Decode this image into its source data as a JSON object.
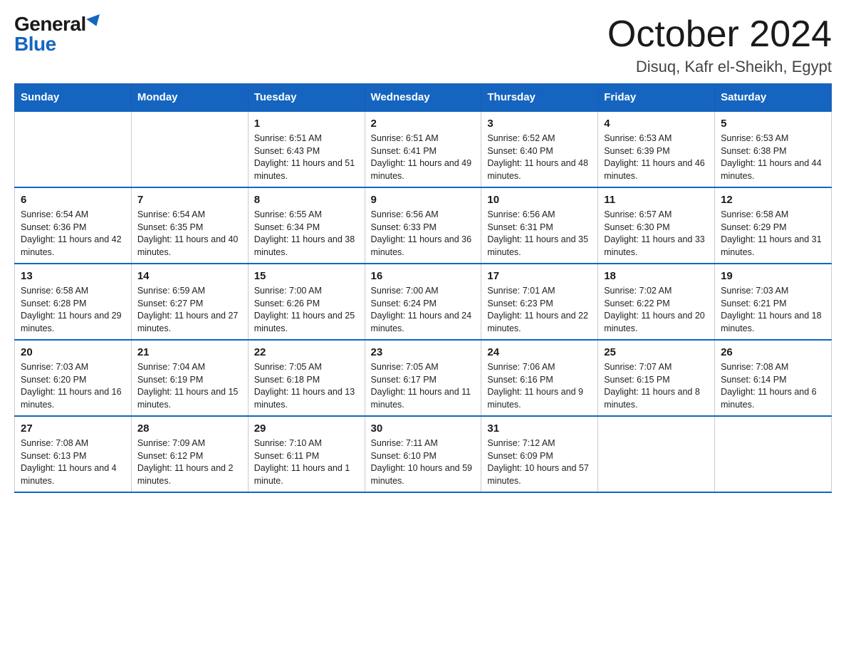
{
  "logo": {
    "general": "General",
    "blue": "Blue"
  },
  "header": {
    "month": "October 2024",
    "location": "Disuq, Kafr el-Sheikh, Egypt"
  },
  "days_of_week": [
    "Sunday",
    "Monday",
    "Tuesday",
    "Wednesday",
    "Thursday",
    "Friday",
    "Saturday"
  ],
  "weeks": [
    [
      {
        "day": "",
        "sunrise": "",
        "sunset": "",
        "daylight": ""
      },
      {
        "day": "",
        "sunrise": "",
        "sunset": "",
        "daylight": ""
      },
      {
        "day": "1",
        "sunrise": "Sunrise: 6:51 AM",
        "sunset": "Sunset: 6:43 PM",
        "daylight": "Daylight: 11 hours and 51 minutes."
      },
      {
        "day": "2",
        "sunrise": "Sunrise: 6:51 AM",
        "sunset": "Sunset: 6:41 PM",
        "daylight": "Daylight: 11 hours and 49 minutes."
      },
      {
        "day": "3",
        "sunrise": "Sunrise: 6:52 AM",
        "sunset": "Sunset: 6:40 PM",
        "daylight": "Daylight: 11 hours and 48 minutes."
      },
      {
        "day": "4",
        "sunrise": "Sunrise: 6:53 AM",
        "sunset": "Sunset: 6:39 PM",
        "daylight": "Daylight: 11 hours and 46 minutes."
      },
      {
        "day": "5",
        "sunrise": "Sunrise: 6:53 AM",
        "sunset": "Sunset: 6:38 PM",
        "daylight": "Daylight: 11 hours and 44 minutes."
      }
    ],
    [
      {
        "day": "6",
        "sunrise": "Sunrise: 6:54 AM",
        "sunset": "Sunset: 6:36 PM",
        "daylight": "Daylight: 11 hours and 42 minutes."
      },
      {
        "day": "7",
        "sunrise": "Sunrise: 6:54 AM",
        "sunset": "Sunset: 6:35 PM",
        "daylight": "Daylight: 11 hours and 40 minutes."
      },
      {
        "day": "8",
        "sunrise": "Sunrise: 6:55 AM",
        "sunset": "Sunset: 6:34 PM",
        "daylight": "Daylight: 11 hours and 38 minutes."
      },
      {
        "day": "9",
        "sunrise": "Sunrise: 6:56 AM",
        "sunset": "Sunset: 6:33 PM",
        "daylight": "Daylight: 11 hours and 36 minutes."
      },
      {
        "day": "10",
        "sunrise": "Sunrise: 6:56 AM",
        "sunset": "Sunset: 6:31 PM",
        "daylight": "Daylight: 11 hours and 35 minutes."
      },
      {
        "day": "11",
        "sunrise": "Sunrise: 6:57 AM",
        "sunset": "Sunset: 6:30 PM",
        "daylight": "Daylight: 11 hours and 33 minutes."
      },
      {
        "day": "12",
        "sunrise": "Sunrise: 6:58 AM",
        "sunset": "Sunset: 6:29 PM",
        "daylight": "Daylight: 11 hours and 31 minutes."
      }
    ],
    [
      {
        "day": "13",
        "sunrise": "Sunrise: 6:58 AM",
        "sunset": "Sunset: 6:28 PM",
        "daylight": "Daylight: 11 hours and 29 minutes."
      },
      {
        "day": "14",
        "sunrise": "Sunrise: 6:59 AM",
        "sunset": "Sunset: 6:27 PM",
        "daylight": "Daylight: 11 hours and 27 minutes."
      },
      {
        "day": "15",
        "sunrise": "Sunrise: 7:00 AM",
        "sunset": "Sunset: 6:26 PM",
        "daylight": "Daylight: 11 hours and 25 minutes."
      },
      {
        "day": "16",
        "sunrise": "Sunrise: 7:00 AM",
        "sunset": "Sunset: 6:24 PM",
        "daylight": "Daylight: 11 hours and 24 minutes."
      },
      {
        "day": "17",
        "sunrise": "Sunrise: 7:01 AM",
        "sunset": "Sunset: 6:23 PM",
        "daylight": "Daylight: 11 hours and 22 minutes."
      },
      {
        "day": "18",
        "sunrise": "Sunrise: 7:02 AM",
        "sunset": "Sunset: 6:22 PM",
        "daylight": "Daylight: 11 hours and 20 minutes."
      },
      {
        "day": "19",
        "sunrise": "Sunrise: 7:03 AM",
        "sunset": "Sunset: 6:21 PM",
        "daylight": "Daylight: 11 hours and 18 minutes."
      }
    ],
    [
      {
        "day": "20",
        "sunrise": "Sunrise: 7:03 AM",
        "sunset": "Sunset: 6:20 PM",
        "daylight": "Daylight: 11 hours and 16 minutes."
      },
      {
        "day": "21",
        "sunrise": "Sunrise: 7:04 AM",
        "sunset": "Sunset: 6:19 PM",
        "daylight": "Daylight: 11 hours and 15 minutes."
      },
      {
        "day": "22",
        "sunrise": "Sunrise: 7:05 AM",
        "sunset": "Sunset: 6:18 PM",
        "daylight": "Daylight: 11 hours and 13 minutes."
      },
      {
        "day": "23",
        "sunrise": "Sunrise: 7:05 AM",
        "sunset": "Sunset: 6:17 PM",
        "daylight": "Daylight: 11 hours and 11 minutes."
      },
      {
        "day": "24",
        "sunrise": "Sunrise: 7:06 AM",
        "sunset": "Sunset: 6:16 PM",
        "daylight": "Daylight: 11 hours and 9 minutes."
      },
      {
        "day": "25",
        "sunrise": "Sunrise: 7:07 AM",
        "sunset": "Sunset: 6:15 PM",
        "daylight": "Daylight: 11 hours and 8 minutes."
      },
      {
        "day": "26",
        "sunrise": "Sunrise: 7:08 AM",
        "sunset": "Sunset: 6:14 PM",
        "daylight": "Daylight: 11 hours and 6 minutes."
      }
    ],
    [
      {
        "day": "27",
        "sunrise": "Sunrise: 7:08 AM",
        "sunset": "Sunset: 6:13 PM",
        "daylight": "Daylight: 11 hours and 4 minutes."
      },
      {
        "day": "28",
        "sunrise": "Sunrise: 7:09 AM",
        "sunset": "Sunset: 6:12 PM",
        "daylight": "Daylight: 11 hours and 2 minutes."
      },
      {
        "day": "29",
        "sunrise": "Sunrise: 7:10 AM",
        "sunset": "Sunset: 6:11 PM",
        "daylight": "Daylight: 11 hours and 1 minute."
      },
      {
        "day": "30",
        "sunrise": "Sunrise: 7:11 AM",
        "sunset": "Sunset: 6:10 PM",
        "daylight": "Daylight: 10 hours and 59 minutes."
      },
      {
        "day": "31",
        "sunrise": "Sunrise: 7:12 AM",
        "sunset": "Sunset: 6:09 PM",
        "daylight": "Daylight: 10 hours and 57 minutes."
      },
      {
        "day": "",
        "sunrise": "",
        "sunset": "",
        "daylight": ""
      },
      {
        "day": "",
        "sunrise": "",
        "sunset": "",
        "daylight": ""
      }
    ]
  ]
}
